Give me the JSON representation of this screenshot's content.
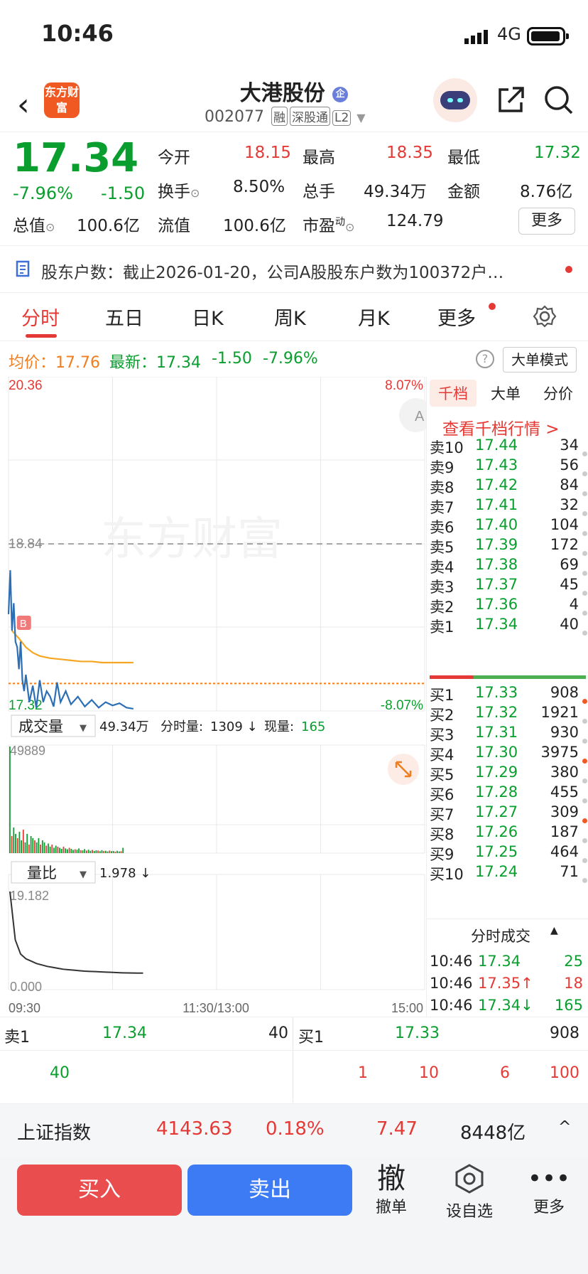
{
  "status_bar": {
    "time": "10:46",
    "network": "4G"
  },
  "header": {
    "logo_text": "东方财富",
    "stock_name": "大港股份",
    "badge": "企",
    "code": "002077",
    "tags": [
      "融",
      "深股通",
      "L2"
    ]
  },
  "quote": {
    "price": "17.34",
    "change_pct": "-7.96%",
    "change": "-1.50",
    "open_label": "今开",
    "open": "18.15",
    "high_label": "最高",
    "high": "18.35",
    "low_label": "最低",
    "low": "17.32",
    "turnover_label": "换手",
    "turnover": "8.50%",
    "volume_label": "总手",
    "volume": "49.34万",
    "amount_label": "金额",
    "amount": "8.76亿",
    "mcap_label": "总值",
    "mcap": "100.6亿",
    "float_label": "流值",
    "float": "100.6亿",
    "pe_label": "市盈",
    "pe_sup": "动",
    "pe": "124.79",
    "more": "更多"
  },
  "info_bar": {
    "text": "股东户数：截止2026-01-20，公司A股股东户数为100372户…"
  },
  "tabs": [
    "分时",
    "五日",
    "日K",
    "周K",
    "月K",
    "更多"
  ],
  "sub_bar": {
    "avg_label": "均价：",
    "avg": "17.76",
    "latest_label": "最新：",
    "latest": "17.34",
    "chg": "-1.50",
    "chg_pct": "-7.96%",
    "mode": "大单模式"
  },
  "chart_data": {
    "type": "line",
    "title": "",
    "y_axis_left": {
      "max": "20.36",
      "min": "17.32"
    },
    "y_axis_right": {
      "max": "8.07%",
      "min": "-8.07%"
    },
    "ylim": [
      17.32,
      20.36
    ],
    "prev_close": 18.84,
    "prev_close_label": "18.84",
    "last_price": 17.34,
    "x_ticks": [
      "09:30",
      "11:30/13:00",
      "15:00"
    ],
    "marker": "B",
    "series": [
      {
        "name": "",
        "color": "#2d6fb5",
        "x": [
          0,
          1,
          2,
          3,
          4,
          5,
          6,
          7,
          8,
          9,
          10,
          12,
          14,
          16,
          18,
          20,
          22,
          24,
          26,
          28,
          30,
          33,
          36,
          40,
          44,
          48,
          52,
          56,
          60,
          64,
          68,
          72
        ],
        "values": [
          18.2,
          18.6,
          18.05,
          18.3,
          17.95,
          17.9,
          17.7,
          17.95,
          17.6,
          17.5,
          17.65,
          17.4,
          17.55,
          17.35,
          17.6,
          17.4,
          17.5,
          17.45,
          17.36,
          17.58,
          17.4,
          17.5,
          17.38,
          17.45,
          17.36,
          17.42,
          17.35,
          17.4,
          17.37,
          17.39,
          17.35,
          17.34
        ]
      },
      {
        "name": "",
        "color": "#f5a623",
        "x": [
          2,
          6,
          10,
          14,
          18,
          24,
          30,
          36,
          42,
          48,
          54,
          60,
          66,
          72
        ],
        "values": [
          18.05,
          17.98,
          17.9,
          17.85,
          17.82,
          17.8,
          17.79,
          17.78,
          17.77,
          17.77,
          17.76,
          17.76,
          17.76,
          17.76
        ]
      }
    ],
    "volume_header": {
      "selector": "成交量",
      "total": "49.34万",
      "tick_label": "分时量:",
      "tick": "1309 ↓",
      "now_label": "现量:",
      "now": "165"
    },
    "volume_max_label": "49889",
    "volume_bars": [
      49889,
      8000,
      12000,
      9000,
      7000,
      10000,
      6000,
      11000,
      5000,
      9000,
      4000,
      8000,
      7000,
      6000,
      5000,
      7000,
      4000,
      6000,
      5000,
      3500,
      4500,
      3000,
      4000,
      2500,
      3500,
      3000,
      2500,
      2000,
      3000,
      2200,
      1800,
      2500,
      2000,
      1500,
      1800,
      1600,
      2200,
      1400,
      1300,
      1900,
      1200,
      1600,
      1100,
      1500,
      1000,
      1300,
      1200,
      900,
      1400,
      1000,
      1100,
      800,
      1200,
      900,
      1000,
      700,
      1100,
      800,
      900,
      2500
    ],
    "ratio_header": {
      "selector": "量比",
      "value": "1.978 ↓"
    },
    "ratio_max_label": "19.182",
    "ratio_min_label": "0.000",
    "ratio_values": [
      19.182,
      9,
      6,
      5,
      4.5,
      4,
      3.7,
      3.4,
      3.2,
      3,
      2.8,
      2.7,
      2.6,
      2.5,
      2.4,
      2.35,
      2.3,
      2.25,
      2.2,
      2.15,
      2.1,
      2.05,
      2.02,
      2.0,
      1.99,
      1.978
    ]
  },
  "order_book": {
    "tabs": [
      "千档",
      "大单",
      "分价"
    ],
    "link": "查看千档行情 >",
    "asks": [
      {
        "label": "卖10",
        "price": "17.44",
        "vol": "34"
      },
      {
        "label": "卖9",
        "price": "17.43",
        "vol": "56"
      },
      {
        "label": "卖8",
        "price": "17.42",
        "vol": "84"
      },
      {
        "label": "卖7",
        "price": "17.41",
        "vol": "32"
      },
      {
        "label": "卖6",
        "price": "17.40",
        "vol": "104"
      },
      {
        "label": "卖5",
        "price": "17.39",
        "vol": "172"
      },
      {
        "label": "卖4",
        "price": "17.38",
        "vol": "69"
      },
      {
        "label": "卖3",
        "price": "17.37",
        "vol": "45"
      },
      {
        "label": "卖2",
        "price": "17.36",
        "vol": "4"
      },
      {
        "label": "卖1",
        "price": "17.34",
        "vol": "40"
      }
    ],
    "bids": [
      {
        "label": "买1",
        "price": "17.33",
        "vol": "908"
      },
      {
        "label": "买2",
        "price": "17.32",
        "vol": "1921"
      },
      {
        "label": "买3",
        "price": "17.31",
        "vol": "930"
      },
      {
        "label": "买4",
        "price": "17.30",
        "vol": "3975"
      },
      {
        "label": "买5",
        "price": "17.29",
        "vol": "380"
      },
      {
        "label": "买6",
        "price": "17.28",
        "vol": "455"
      },
      {
        "label": "买7",
        "price": "17.27",
        "vol": "309"
      },
      {
        "label": "买8",
        "price": "17.26",
        "vol": "187"
      },
      {
        "label": "买9",
        "price": "17.25",
        "vol": "464"
      },
      {
        "label": "买10",
        "price": "17.24",
        "vol": "71"
      }
    ],
    "trades_title": "分时成交",
    "trades": [
      {
        "time": "10:46",
        "price": "17.34",
        "vol": "25"
      },
      {
        "time": "10:46",
        "price": "17.35↑",
        "vol": "18"
      },
      {
        "time": "10:46",
        "price": "17.34↓",
        "vol": "165"
      }
    ]
  },
  "board": {
    "sell_label": "卖1",
    "sell_price": "17.34",
    "sell_vol": "40",
    "buy_label": "买1",
    "buy_price": "17.33",
    "buy_vol": "908",
    "sell_queue": [
      "40"
    ],
    "buy_queue": [
      "1",
      "10",
      "6",
      "100"
    ]
  },
  "index_bar": {
    "name": "上证指数",
    "value": "4143.63",
    "pct": "0.18%",
    "chg": "7.47",
    "amount": "8448亿"
  },
  "bottom": {
    "buy": "买入",
    "sell": "卖出",
    "cancel_icon": "撤",
    "cancel": "撤单",
    "watch": "设自选",
    "more": "更多"
  }
}
